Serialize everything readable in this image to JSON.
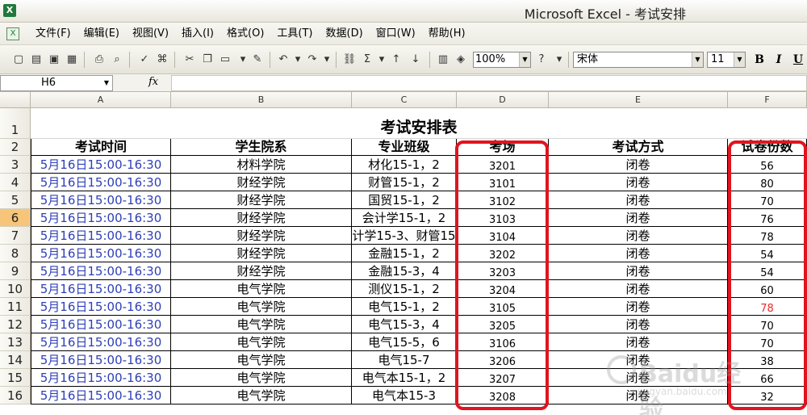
{
  "window": {
    "title": "Microsoft Excel - 考试安排"
  },
  "menu": [
    "文件(F)",
    "编辑(E)",
    "视图(V)",
    "插入(I)",
    "格式(O)",
    "工具(T)",
    "数据(D)",
    "窗口(W)",
    "帮助(H)"
  ],
  "toolbar": {
    "zoom": "100%",
    "font": "宋体",
    "font_size": "11",
    "bold": "B",
    "italic": "I",
    "underline": "U"
  },
  "formula_bar": {
    "cell_ref": "H6",
    "fx": "fx",
    "value": ""
  },
  "columns": [
    "A",
    "B",
    "C",
    "D",
    "E",
    "F"
  ],
  "rows": [
    "1",
    "2",
    "3",
    "4",
    "5",
    "6",
    "7",
    "8",
    "9",
    "10",
    "11",
    "12",
    "13",
    "14",
    "15",
    "16"
  ],
  "sheet": {
    "title": "考试安排表",
    "headers": [
      "考试时间",
      "学生院系",
      "专业班级",
      "考场",
      "考试方式",
      "试卷份数"
    ],
    "data": [
      [
        "5月16日15:00-16:30",
        "材料学院",
        "材化15-1，2",
        "3201",
        "闭卷",
        "56"
      ],
      [
        "5月16日15:00-16:30",
        "财经学院",
        "财管15-1，2",
        "3101",
        "闭卷",
        "80"
      ],
      [
        "5月16日15:00-16:30",
        "财经学院",
        "国贸15-1，2",
        "3102",
        "闭卷",
        "70"
      ],
      [
        "5月16日15:00-16:30",
        "财经学院",
        "会计学15-1，2",
        "3103",
        "闭卷",
        "76"
      ],
      [
        "5月16日15:00-16:30",
        "财经学院",
        "计学15-3、财管15",
        "3104",
        "闭卷",
        "78"
      ],
      [
        "5月16日15:00-16:30",
        "财经学院",
        "金融15-1，2",
        "3202",
        "闭卷",
        "54"
      ],
      [
        "5月16日15:00-16:30",
        "财经学院",
        "金融15-3，4",
        "3203",
        "闭卷",
        "54"
      ],
      [
        "5月16日15:00-16:30",
        "电气学院",
        "测仪15-1，2",
        "3204",
        "闭卷",
        "60"
      ],
      [
        "5月16日15:00-16:30",
        "电气学院",
        "电气15-1，2",
        "3105",
        "闭卷",
        "78"
      ],
      [
        "5月16日15:00-16:30",
        "电气学院",
        "电气15-3，4",
        "3205",
        "闭卷",
        "70"
      ],
      [
        "5月16日15:00-16:30",
        "电气学院",
        "电气15-5，6",
        "3106",
        "闭卷",
        "70"
      ],
      [
        "5月16日15:00-16:30",
        "电气学院",
        "电气15-7",
        "3206",
        "闭卷",
        "38"
      ],
      [
        "5月16日15:00-16:30",
        "电气学院",
        "电气本15-1，2",
        "3207",
        "闭卷",
        "66"
      ],
      [
        "5月16日15:00-16:30",
        "电气学院",
        "电气本15-3",
        "3208",
        "闭卷",
        "32"
      ]
    ],
    "highlight_red_row": 8
  },
  "colors": {
    "time_text": "#2e3fb7",
    "red_text": "#e62b2b",
    "annotation": "#e1141f",
    "active_row": "#f7c57a"
  },
  "watermark": {
    "text": "Baidu经验",
    "url": "jingyan.baidu.com"
  }
}
